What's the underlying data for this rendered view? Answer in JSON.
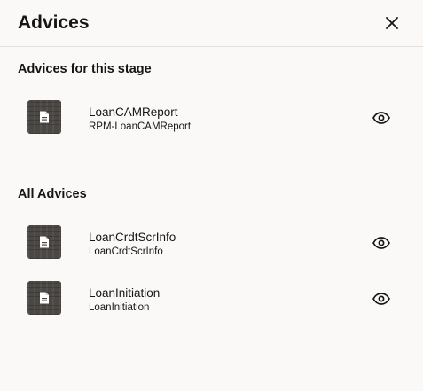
{
  "dialog": {
    "title": "Advices",
    "close_icon": "close-icon"
  },
  "sections": {
    "stage": {
      "title": "Advices for this stage",
      "items": [
        {
          "name": "LoanCAMReport",
          "subtitle": "RPM-LoanCAMReport",
          "icon": "document-icon",
          "action_icon": "eye-icon"
        }
      ]
    },
    "all": {
      "title": "All Advices",
      "items": [
        {
          "name": "LoanCrdtScrInfo",
          "subtitle": "LoanCrdtScrInfo",
          "icon": "document-icon",
          "action_icon": "eye-icon"
        },
        {
          "name": "LoanInitiation",
          "subtitle": "LoanInitiation",
          "icon": "document-icon",
          "action_icon": "eye-icon"
        }
      ]
    }
  },
  "colors": {
    "background": "#fbf9f8",
    "text": "#161513",
    "divider": "#e4e1dd",
    "thumbnail": "#4b4844"
  }
}
